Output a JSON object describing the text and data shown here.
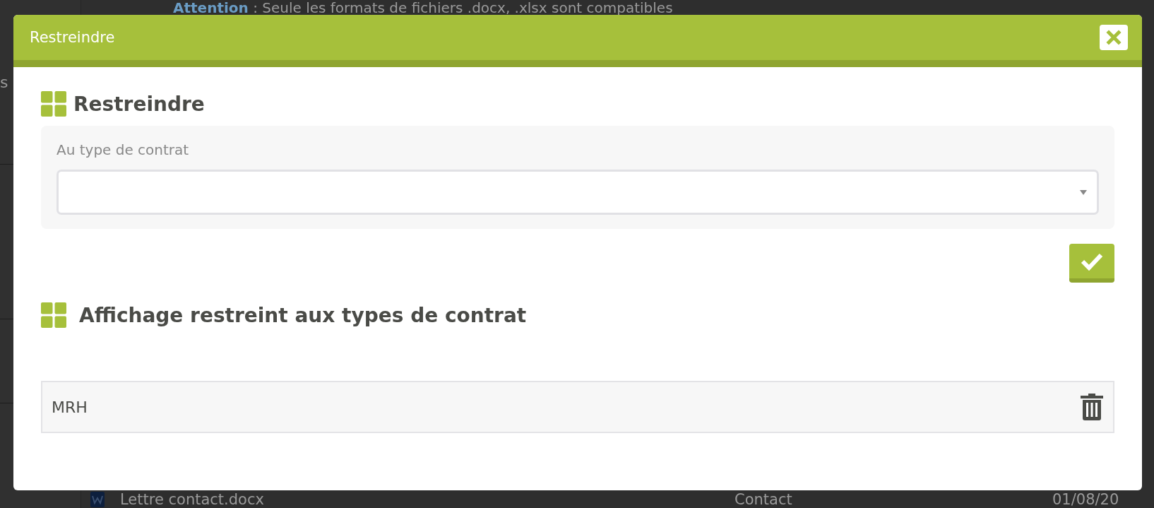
{
  "background": {
    "notice": {
      "label": "Attention",
      "text": ": Seule les formats de fichiers .docx, .xlsx sont compatibles"
    },
    "sidebar_text": "s",
    "row": {
      "name": "Lettre contact.docx",
      "category": "Contact",
      "date": "01/08/20"
    }
  },
  "dialog": {
    "title": "Restreindre",
    "section_title": "Restreindre",
    "field": {
      "label": "Au type de contrat"
    },
    "list_title": "Affichage restreint aux types de contrat",
    "items": [
      {
        "name": "MRH"
      }
    ]
  }
}
